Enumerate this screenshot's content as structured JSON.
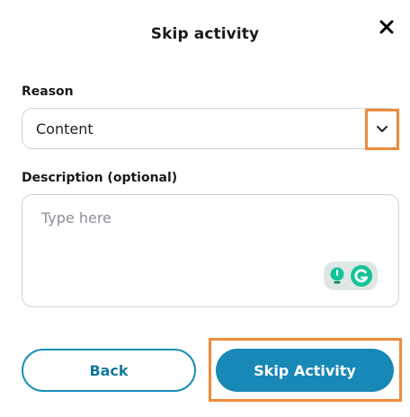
{
  "dialog": {
    "title": "Skip activity",
    "close_icon": "close-icon"
  },
  "form": {
    "reason_label": "Reason",
    "reason_value": "Content",
    "reason_chevron_icon": "chevron-down-icon",
    "description_label": "Description (optional)",
    "description_value": "",
    "description_placeholder": "Type here",
    "grammarly_icons": [
      "lightbulb-icon",
      "grammarly-icon"
    ]
  },
  "actions": {
    "back_label": "Back",
    "skip_label": "Skip Activity"
  },
  "colors": {
    "accent": "#1888b6",
    "highlight": "#ee8a3c",
    "border": "#cfd4da",
    "grammarly_green": "#15c39a"
  }
}
